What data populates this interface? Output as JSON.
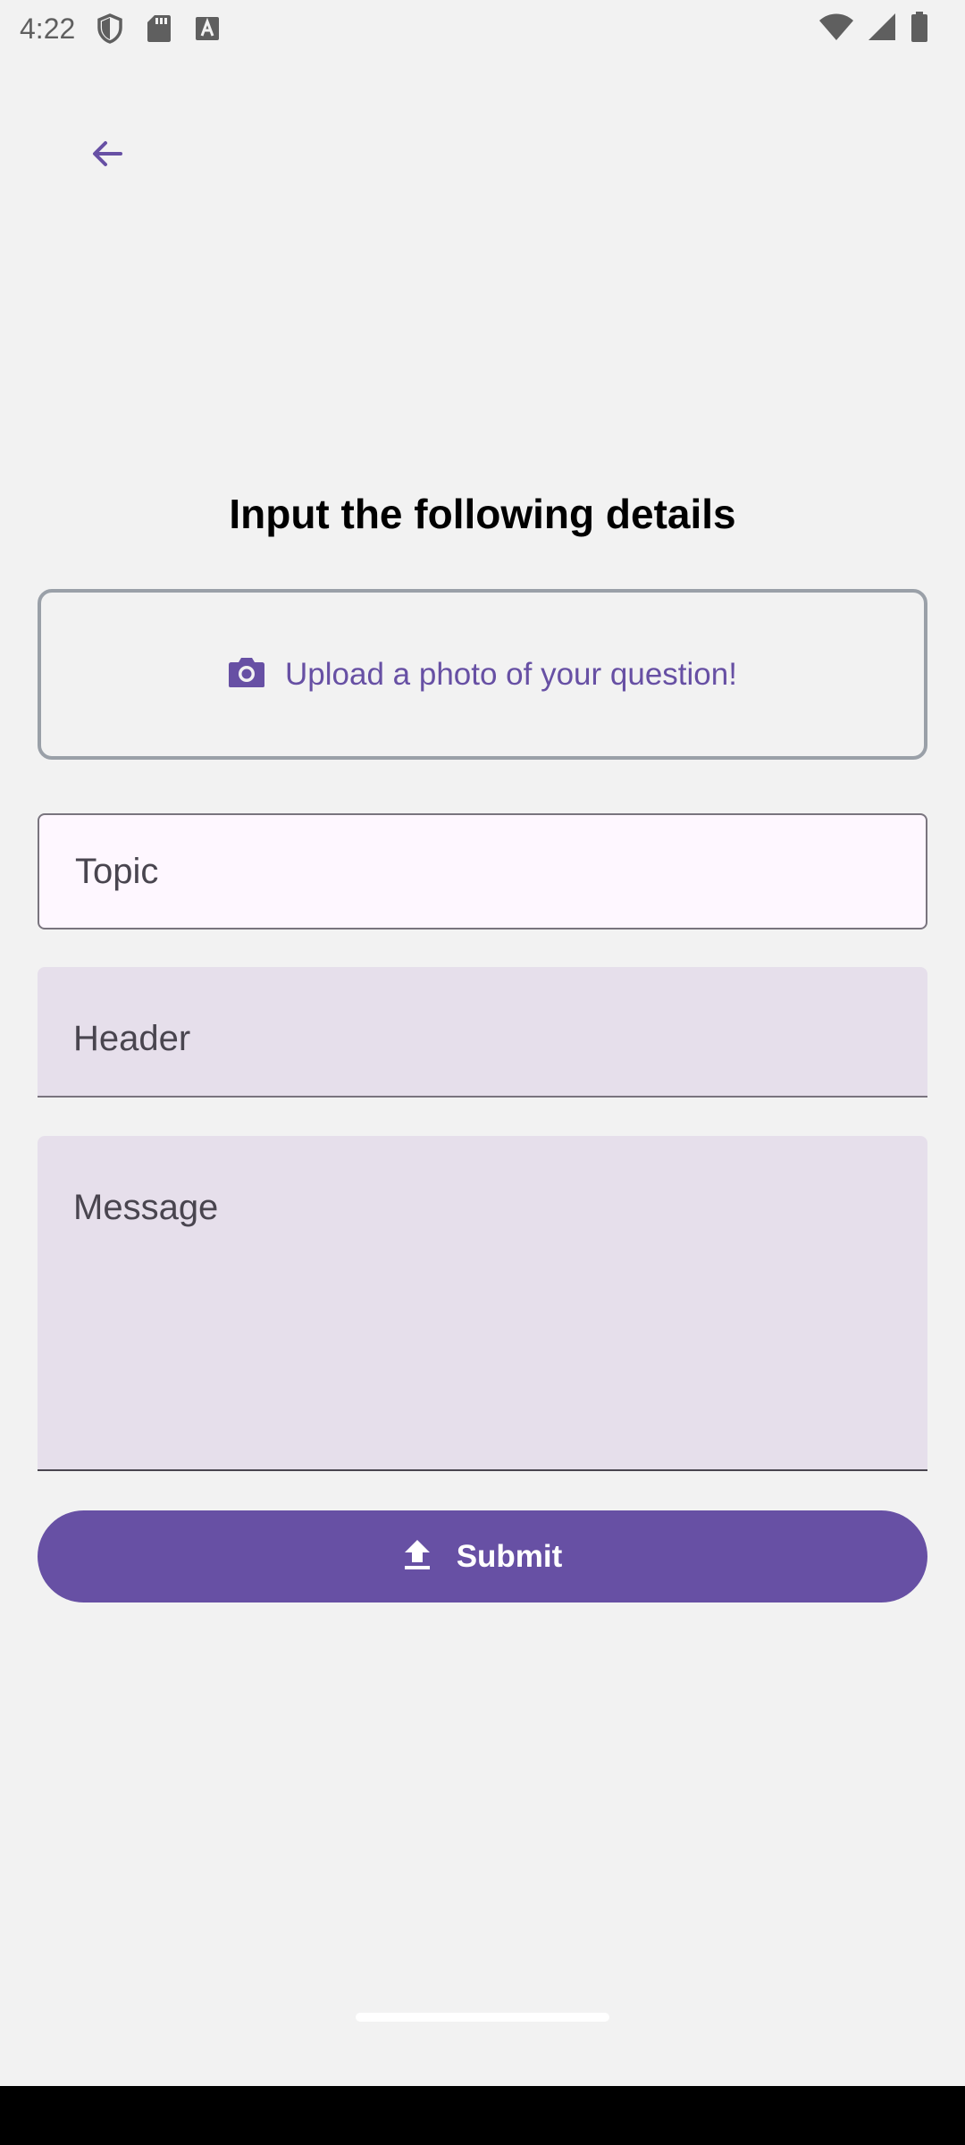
{
  "status_bar": {
    "time": "4:22",
    "left_icons": [
      "shield-icon",
      "sd-card-icon",
      "text-a-icon"
    ],
    "right_icons": [
      "wifi-icon",
      "signal-icon",
      "battery-icon"
    ]
  },
  "header": {
    "back_icon": "arrow-back-icon"
  },
  "form": {
    "title": "Input the following details",
    "upload": {
      "icon": "camera-icon",
      "label": "Upload a photo of your question!"
    },
    "topic_placeholder": "Topic",
    "header_placeholder": "Header",
    "message_placeholder": "Message",
    "submit": {
      "icon": "upload-icon",
      "label": "Submit"
    }
  },
  "colors": {
    "accent": "#6750a4",
    "background": "#f2f2f2",
    "filled_field": "#e6dfeb",
    "outlined_field": "#fef7ff",
    "outline": "#79747e"
  }
}
